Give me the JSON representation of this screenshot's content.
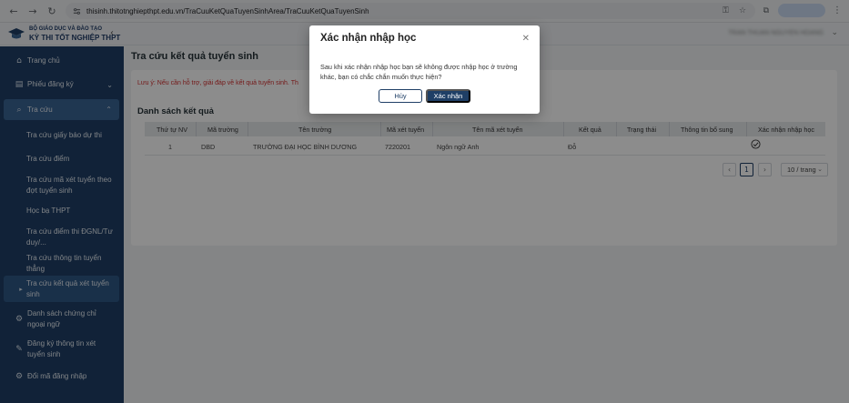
{
  "browser": {
    "url": "thisinh.thitotnghiepthpt.edu.vn/TraCuuKetQuaTuyenSinhArea/TraCuuKetQuaTuyenSinh"
  },
  "header": {
    "logo_line1": "BỘ GIÁO DỤC VÀ ĐÀO TẠO",
    "logo_line2": "KỲ THI TỐT NGHIỆP THPT",
    "user_name": "TRAN THUAN NGUYEN HOANG",
    "brand_color": "#1f3f66"
  },
  "sidebar": {
    "items": [
      {
        "label": "Trang chủ",
        "icon": "home-icon"
      },
      {
        "label": "Phiếu đăng ký",
        "icon": "document-icon"
      },
      {
        "label": "Tra cứu",
        "icon": "search-icon"
      },
      {
        "label": "Tra cứu giấy báo dự thi"
      },
      {
        "label": "Tra cứu điểm"
      },
      {
        "label": "Tra cứu mã xét tuyển theo đợt tuyển sinh"
      },
      {
        "label": "Học bạ THPT"
      },
      {
        "label": "Tra cứu điểm thi ĐGNL/Tư duy/..."
      },
      {
        "label": "Tra cứu thông tin tuyển thẳng"
      },
      {
        "label": "Tra cứu kết quả xét tuyển sinh"
      },
      {
        "label": "Danh sách chứng chỉ ngoại ngữ",
        "icon": "gear-icon"
      },
      {
        "label": "Đăng ký thông tin xét tuyển sinh",
        "icon": "edit-icon"
      },
      {
        "label": "Đổi mã đăng nhập",
        "icon": "settings-icon"
      }
    ]
  },
  "main": {
    "page_title": "Tra cứu kết quả tuyển sinh",
    "notice": "Lưu ý: Nếu cần hỗ trợ, giải đáp về kết quả tuyển sinh. Th",
    "section_title": "Danh sách kết quả",
    "table": {
      "headers": [
        "Thứ tự NV",
        "Mã trường",
        "Tên trường",
        "Mã xét tuyển",
        "Tên mã xét tuyển",
        "Kết quả",
        "Trạng thái",
        "Thông tin bổ sung",
        "Xác nhận nhập học"
      ],
      "rows": [
        [
          "1",
          "DBD",
          "TRƯỜNG ĐẠI HỌC BÌNH DƯƠNG",
          "7220201",
          "Ngôn ngữ Anh",
          "Đỗ",
          "",
          "",
          ""
        ]
      ]
    },
    "pagination": {
      "current_page": "1",
      "page_size": "10 / trang"
    }
  },
  "modal": {
    "title": "Xác nhận nhập học",
    "body": "Sau khi xác nhận nhập học bạn sẽ không được nhập học ở trường khác, bạn có chắc chắn muốn thực hiện?",
    "cancel_label": "Hủy",
    "confirm_label": "Xác nhận"
  }
}
